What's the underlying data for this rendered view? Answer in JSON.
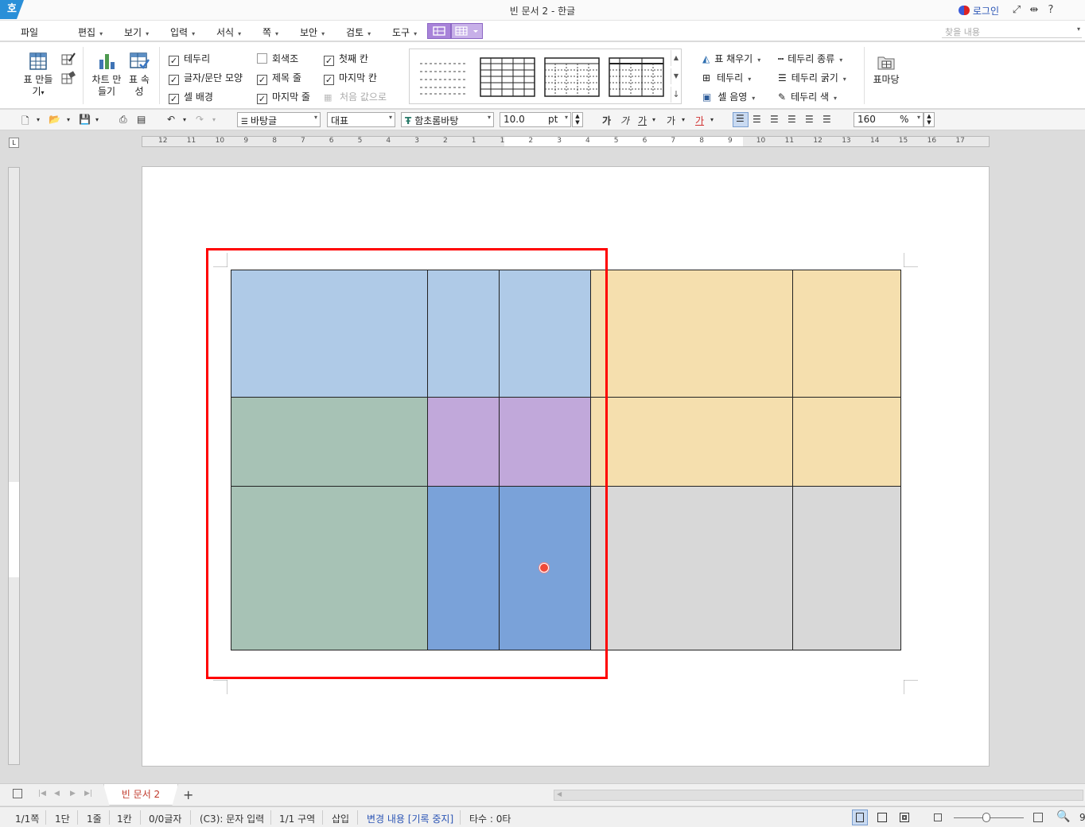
{
  "app": {
    "logo_text": "호",
    "title": "빈 문서 2 - 한글",
    "login_label": "로그인",
    "controls": [
      "⤢",
      "⇹",
      "?"
    ]
  },
  "menu": {
    "items": [
      "파일",
      "편집",
      "보기",
      "입력",
      "서식",
      "쪽",
      "보안",
      "검토",
      "도구"
    ],
    "search_placeholder": "찾을 내용"
  },
  "ribbon": {
    "make_table": "표 만들기",
    "chart": "차트 만들기",
    "table_props": "표 속성",
    "checks": [
      {
        "label": "테두리",
        "checked": true
      },
      {
        "label": "글자/문단 모양",
        "checked": true
      },
      {
        "label": "셀 배경",
        "checked": true
      },
      {
        "label": "회색조",
        "checked": false
      },
      {
        "label": "제목 줄",
        "checked": true
      },
      {
        "label": "마지막 줄",
        "checked": true
      },
      {
        "label": "첫째 칸",
        "checked": true
      },
      {
        "label": "마지막 칸",
        "checked": true
      }
    ],
    "reset_label": "처음 값으로",
    "fill": "표 채우기",
    "border": "테두리",
    "cell_shade": "셀 음영",
    "border_type": "테두리 종류",
    "border_width": "테두리 굵기",
    "border_color": "테두리 색",
    "table_cursor": "표마당"
  },
  "toolbar": {
    "style": "바탕글",
    "lang": "대표",
    "font": "함초롬바탕",
    "size": "10.0",
    "size_unit": "pt",
    "zoom": "160",
    "zoom_unit": "%",
    "format_glyphs": [
      "가",
      "가",
      "가",
      "가",
      "가"
    ]
  },
  "ruler": {
    "h_numbers": [
      "12",
      "11",
      "10",
      "9",
      "8",
      "7",
      "6",
      "5",
      "4",
      "3",
      "2",
      "1",
      "1",
      "2",
      "3",
      "4",
      "5",
      "6",
      "7",
      "8",
      "9",
      "10",
      "11",
      "12",
      "13",
      "14",
      "15",
      "16",
      "17"
    ],
    "corner": "L"
  },
  "table": {
    "colors": {
      "light_blue": "#afcae7",
      "sage": "#a7c2b5",
      "lavender": "#c1a8da",
      "mid_blue": "#7aa2d9",
      "sand": "#f5dfae",
      "gray": "#d8d8d8"
    },
    "rows": [
      [
        "light_blue",
        "light_blue",
        "light_blue",
        "sand",
        "sand"
      ],
      [
        "sage",
        "lavender",
        "lavender",
        "sand",
        "sand"
      ],
      [
        "sage",
        "mid_blue",
        "mid_blue",
        "gray",
        "gray"
      ]
    ]
  },
  "tabs": {
    "doc_tab": "빈 문서 2",
    "add": "+"
  },
  "status": {
    "page": "1/1쪽",
    "col": "1단",
    "line": "1줄",
    "cell": "1칸",
    "chars": "0/0글자",
    "mode": "(C3): 문자 입력",
    "section": "1/1 구역",
    "insert": "삽입",
    "track": "변경 내용 [기록 중지]",
    "typing": "타수 : 0타",
    "zoom_edge": "9"
  }
}
